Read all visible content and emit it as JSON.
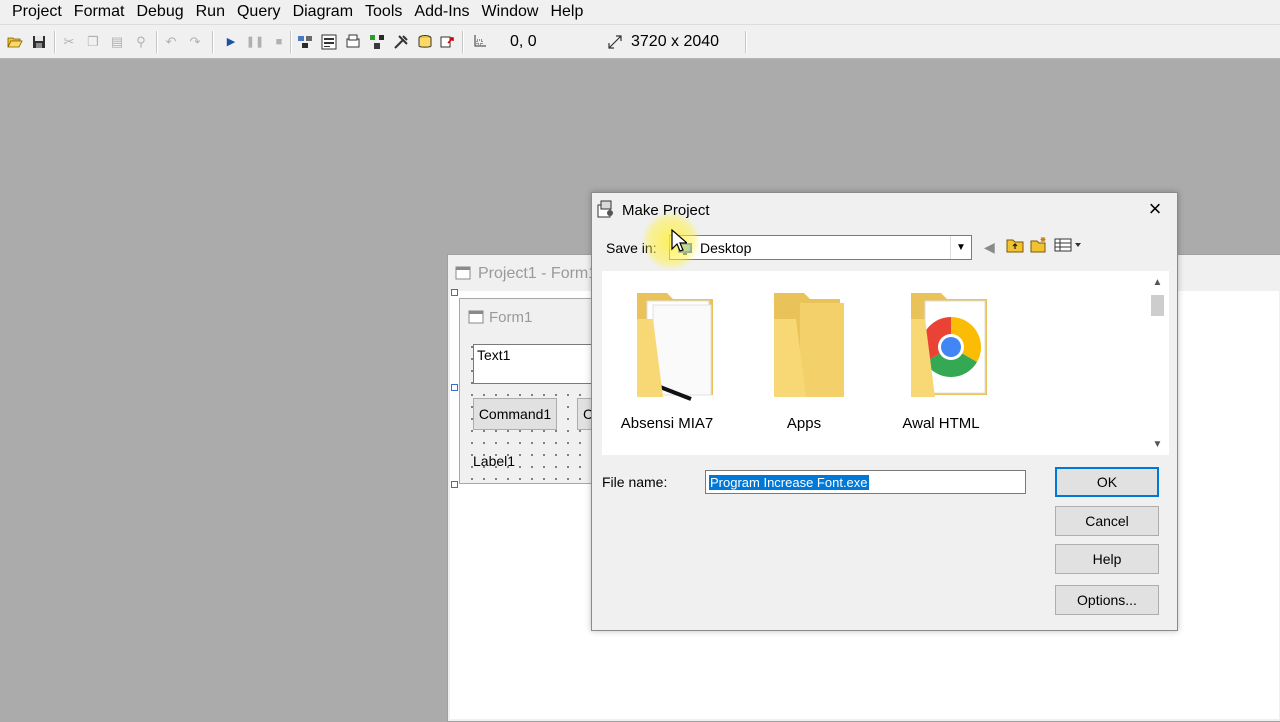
{
  "menu": {
    "items": [
      "Project",
      "Format",
      "Debug",
      "Run",
      "Query",
      "Diagram",
      "Tools",
      "Add-Ins",
      "Window",
      "Help"
    ]
  },
  "toolbar": {
    "position": "0, 0",
    "size": "3720 x 2040"
  },
  "project_window": {
    "title": "Project1 - Form1"
  },
  "form": {
    "title": "Form1",
    "textbox_value": "Text1",
    "command1_label": "Command1",
    "command2_label": "C",
    "label_text": "Label1"
  },
  "dialog": {
    "title": "Make Project",
    "save_in_label": "Save in:",
    "save_in_value": "Desktop",
    "folders": [
      "Absensi MIA7",
      "Apps",
      "Awal HTML"
    ],
    "file_name_label": "File name:",
    "file_name_value": "Program Increase Font.exe",
    "buttons": {
      "ok": "OK",
      "cancel": "Cancel",
      "help": "Help",
      "options": "Options..."
    }
  },
  "colors": {
    "selection": "#0078d7",
    "folder": "#f8d775",
    "workspace": "#ababab"
  }
}
